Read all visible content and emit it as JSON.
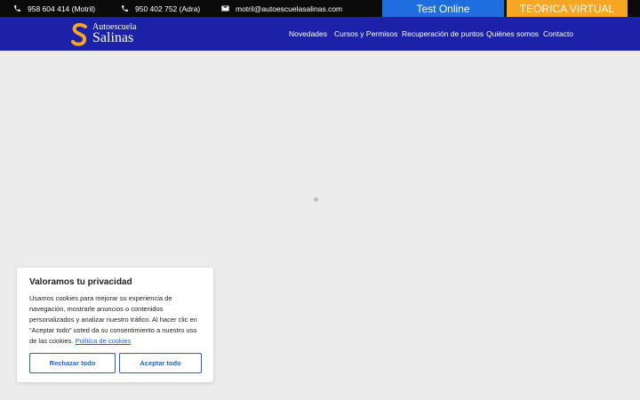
{
  "topbar": {
    "contacts": [
      {
        "icon": "phone-icon",
        "text": "958 604 414 (Motril)"
      },
      {
        "icon": "phone-icon",
        "text": "950 402 752 (Adra)"
      },
      {
        "icon": "envelope-icon",
        "text": "motril@autoescuelasalinas.com"
      }
    ],
    "test_online_label": "Test Online",
    "teorica_label": "TEÓRICA VIRTUAL",
    "colors": {
      "test_online": "#1d6fe0",
      "teorica": "#f5a623",
      "bar": "#0b0b0b"
    }
  },
  "header": {
    "logo": {
      "top": "Autoescuela",
      "bottom": "Salinas"
    },
    "nav": [
      "Novedades",
      "Cursos y Permisos",
      "Recuperación de puntos",
      "Quiénes somos",
      "Contacto"
    ],
    "color": "#1b21a9"
  },
  "cookie_banner": {
    "title": "Valoramos tu privacidad",
    "text": "Usamos cookies para mejorar su experiencia de navegación, mostrarle anuncios o contenidos personalizados y analizar nuestro tráfico. Al hacer clic en “Aceptar todo” usted da su consentimiento a nuestro uso de las cookies.",
    "link": "Política de cookies",
    "reject_label": "Rechazar todo",
    "accept_label": "Aceptar todo",
    "accent": "#1863dc"
  }
}
